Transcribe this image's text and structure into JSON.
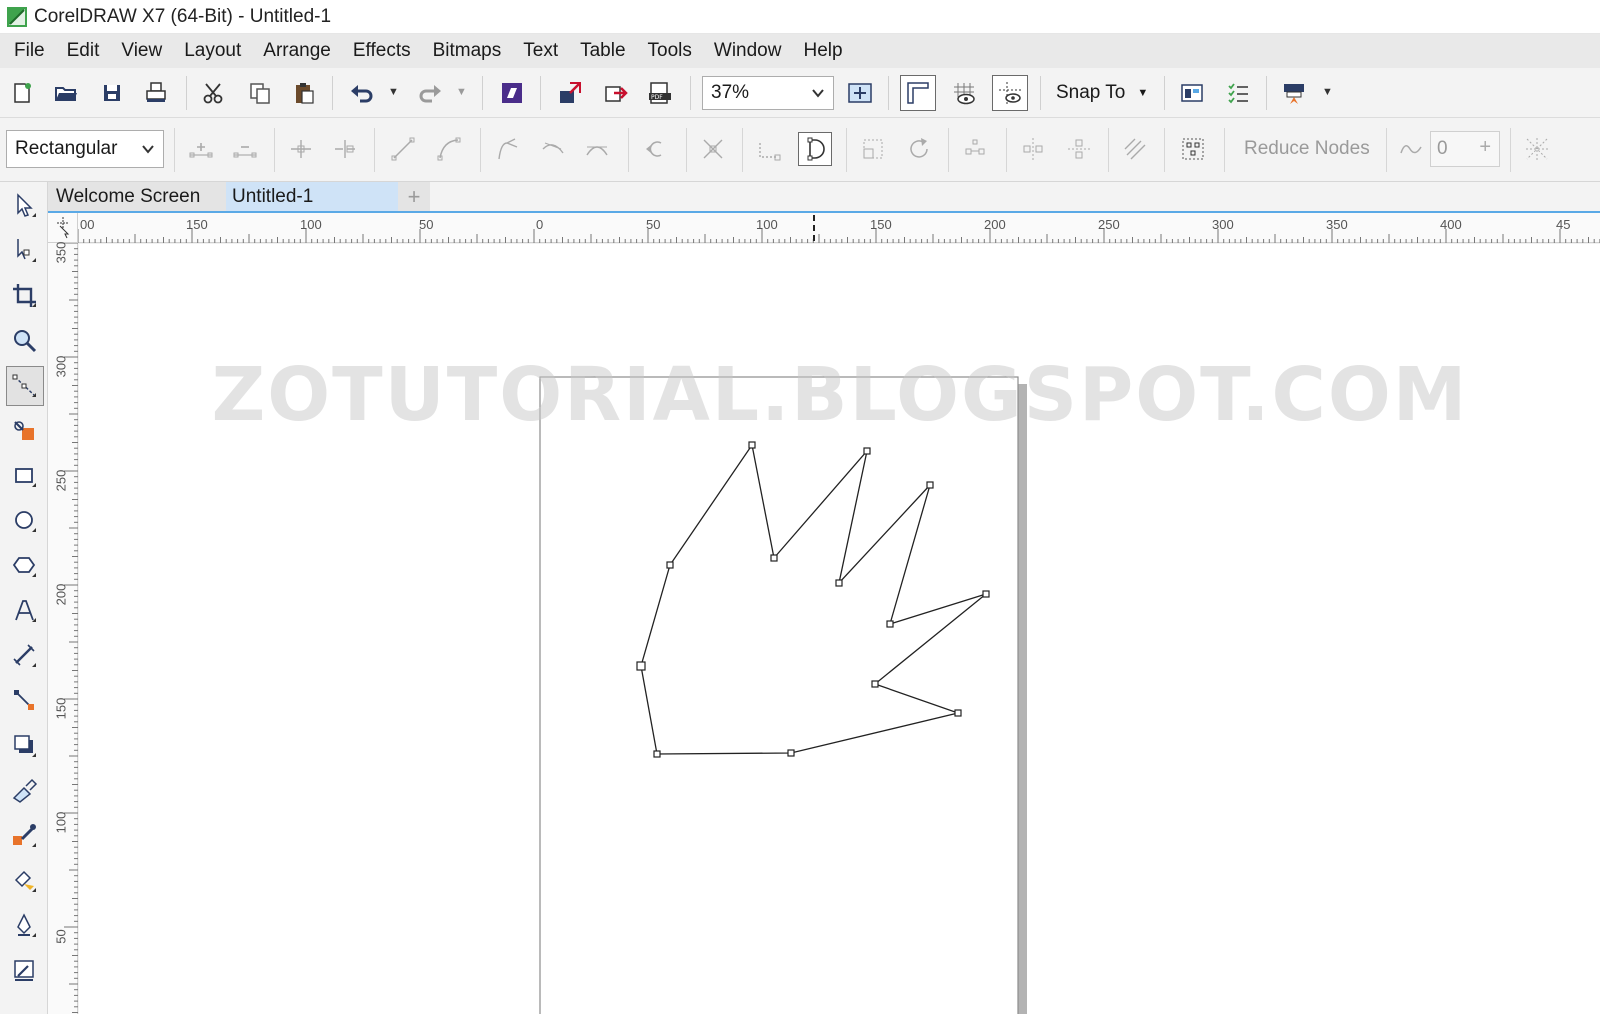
{
  "window": {
    "title": "CorelDRAW X7 (64-Bit) - Untitled-1"
  },
  "menu": {
    "items": [
      "File",
      "Edit",
      "View",
      "Layout",
      "Arrange",
      "Effects",
      "Bitmaps",
      "Text",
      "Table",
      "Tools",
      "Window",
      "Help"
    ]
  },
  "standard_toolbar": {
    "zoom": "37%",
    "snap_to": "Snap To"
  },
  "property_bar": {
    "selection_mode": "Rectangular",
    "reduce_nodes": "Reduce Nodes",
    "curve_smoothness": "0"
  },
  "tabs": {
    "welcome": "Welcome Screen",
    "document": "Untitled-1",
    "add": "+"
  },
  "rulers": {
    "horizontal": [
      "00",
      "150",
      "100",
      "50",
      "0",
      "50",
      "100",
      "150",
      "200",
      "250",
      "300",
      "350",
      "400",
      "45"
    ],
    "vertical": [
      "350",
      "300",
      "250",
      "200",
      "150",
      "100",
      "50"
    ]
  },
  "watermark": "ZOTUTORIAL.BLOGSPOT.COM",
  "colors": {
    "accent": "#5aa9e6",
    "tab_active": "#cfe3f7",
    "brand_green": "#3fa34d"
  }
}
